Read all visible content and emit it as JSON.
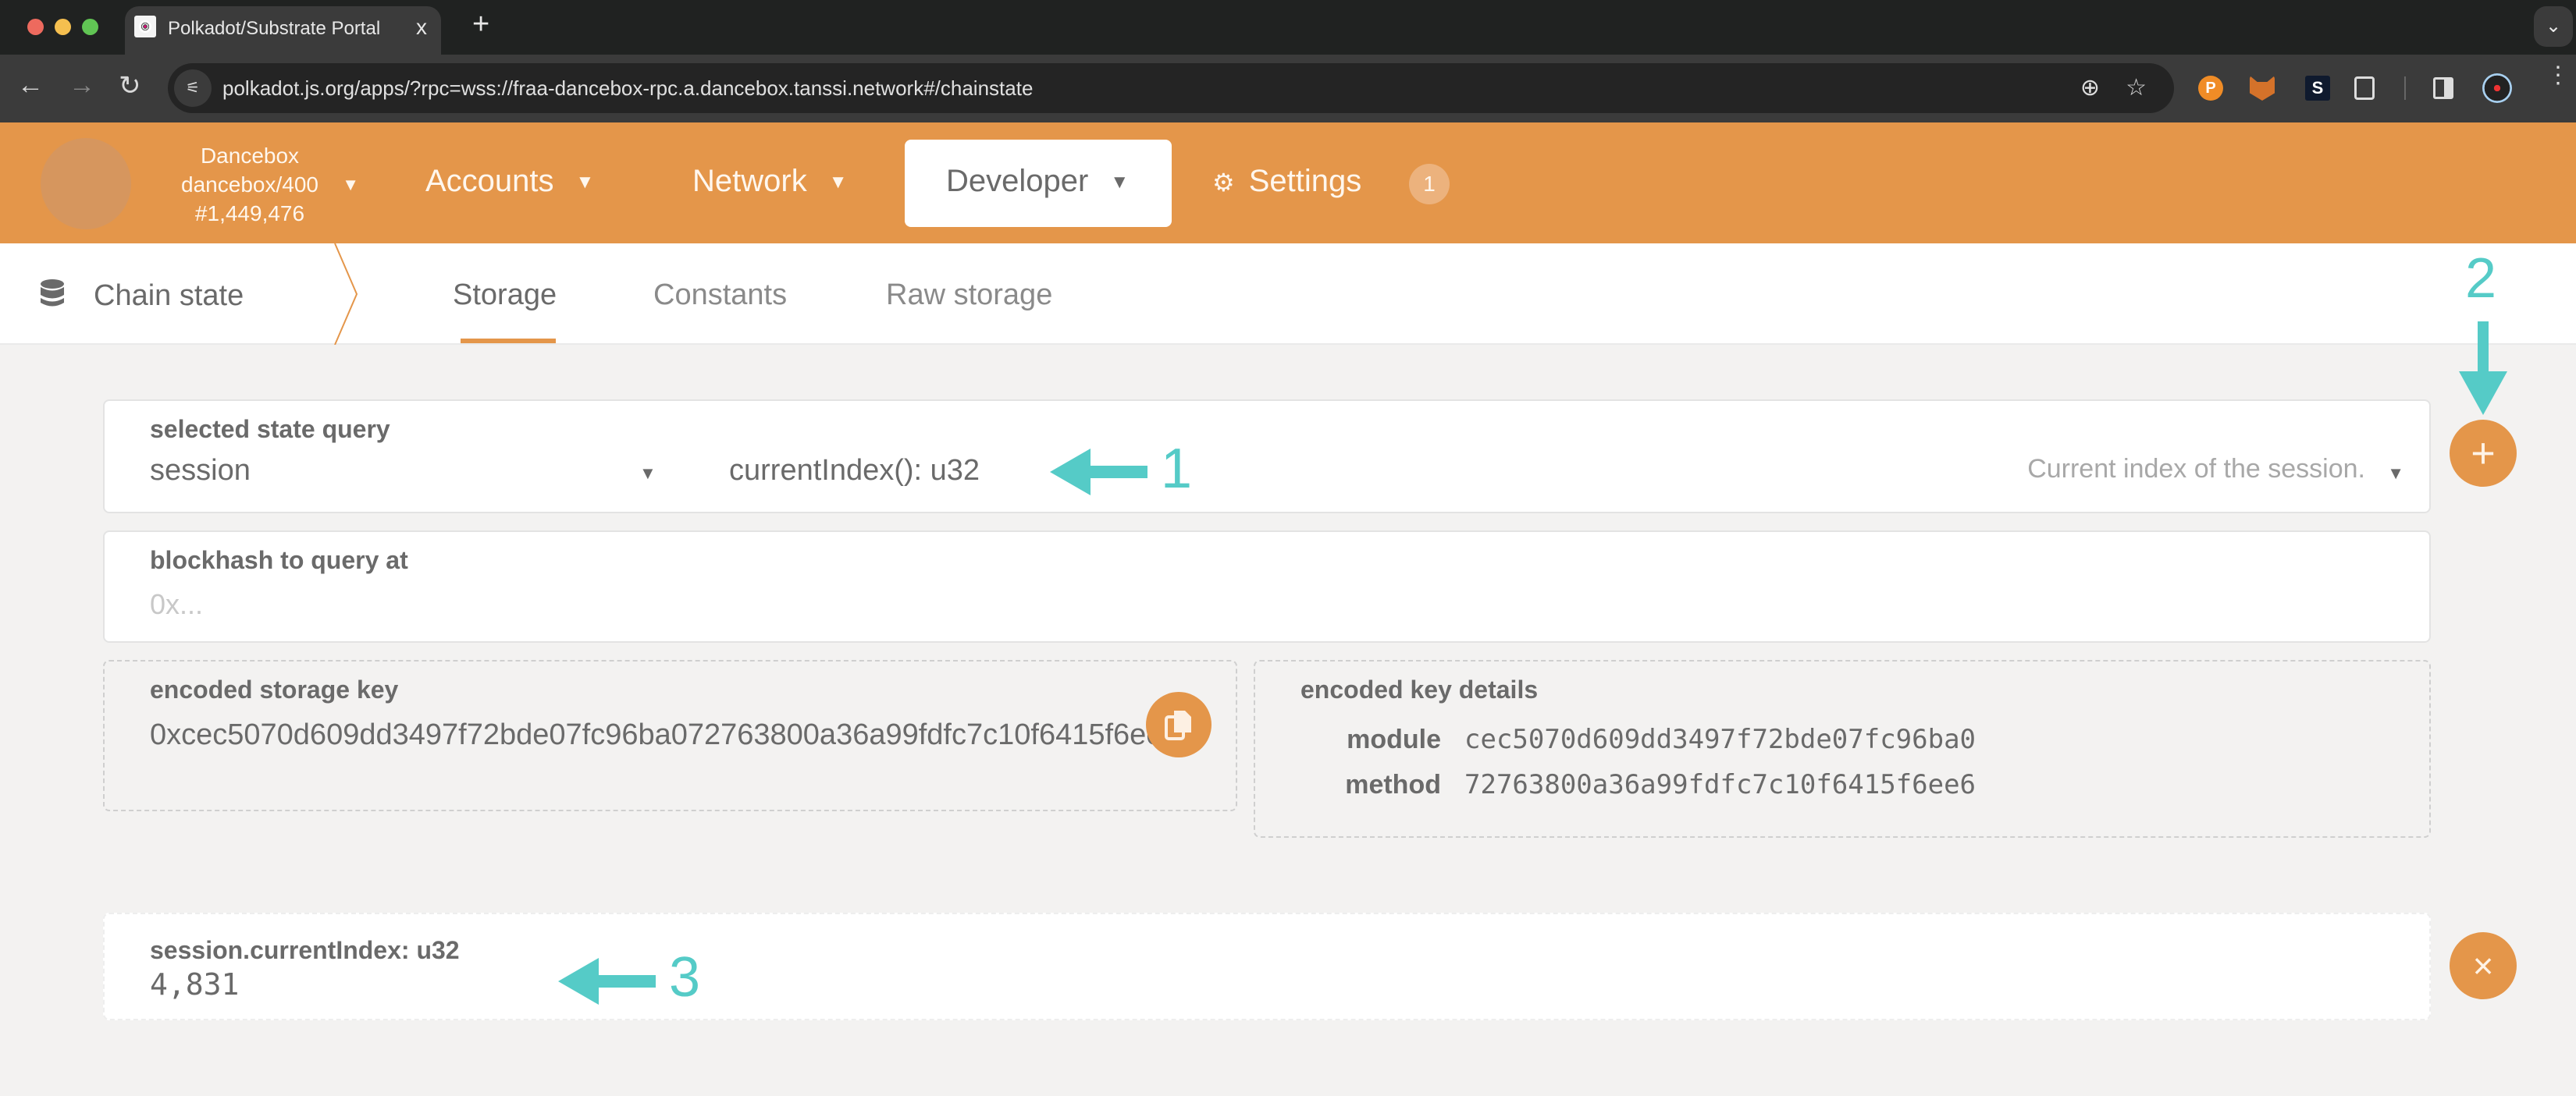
{
  "browser": {
    "tab_title": "Polkadot/Substrate Portal",
    "tab_close": "x",
    "new_tab": "+",
    "tabs_menu": "⌄",
    "url": "polkadot.js.org/apps/?rpc=wss://fraa-dancebox-rpc.a.dancebox.tanssi.network#/chainstate",
    "nav_back": "←",
    "nav_forward": "→",
    "nav_reload": "↻",
    "zoom_icon": "⊕",
    "star_icon": "☆",
    "ext_polkadot": "P",
    "ext_s": "S",
    "kebab": "⋮",
    "site_info": "⚟"
  },
  "header": {
    "chain_name": "Dancebox",
    "chain_spec": "dancebox/400",
    "block_number": "#1,449,476",
    "caret": "▼",
    "menu": {
      "accounts": "Accounts",
      "network": "Network",
      "developer": "Developer",
      "settings": "Settings",
      "settings_badge": "1",
      "gear": "⚙"
    }
  },
  "subnav": {
    "section": "Chain state",
    "tabs": [
      {
        "label": "Storage",
        "active": true
      },
      {
        "label": "Constants",
        "active": false
      },
      {
        "label": "Raw storage",
        "active": false
      }
    ]
  },
  "query": {
    "label": "selected state query",
    "section": "session",
    "method": "currentIndex(): u32",
    "doc": "Current index of the session.",
    "caret": "▼"
  },
  "blockhash": {
    "label": "blockhash to query at",
    "placeholder": "0x..."
  },
  "encoded_key": {
    "label": "encoded storage key",
    "value": "0xcec5070d609dd3497f72bde07fc96ba072763800a36a99fdfc7c10f6415f6ee6"
  },
  "encoded_key_details": {
    "label": "encoded key details",
    "module_label": "module",
    "module_value": "cec5070d609dd3497f72bde07fc96ba0",
    "method_label": "method",
    "method_value": "72763800a36a99fdfc7c10f6415f6ee6"
  },
  "result": {
    "label": "session.currentIndex: u32",
    "value": "4,831"
  },
  "buttons": {
    "add": "+",
    "close": "×"
  },
  "annotations": {
    "one": "1",
    "two": "2",
    "three": "3",
    "color": "#55cbc7"
  },
  "colors": {
    "accent": "#e4964a",
    "text": "#6a6a6a",
    "background": "#f3f2f1"
  }
}
